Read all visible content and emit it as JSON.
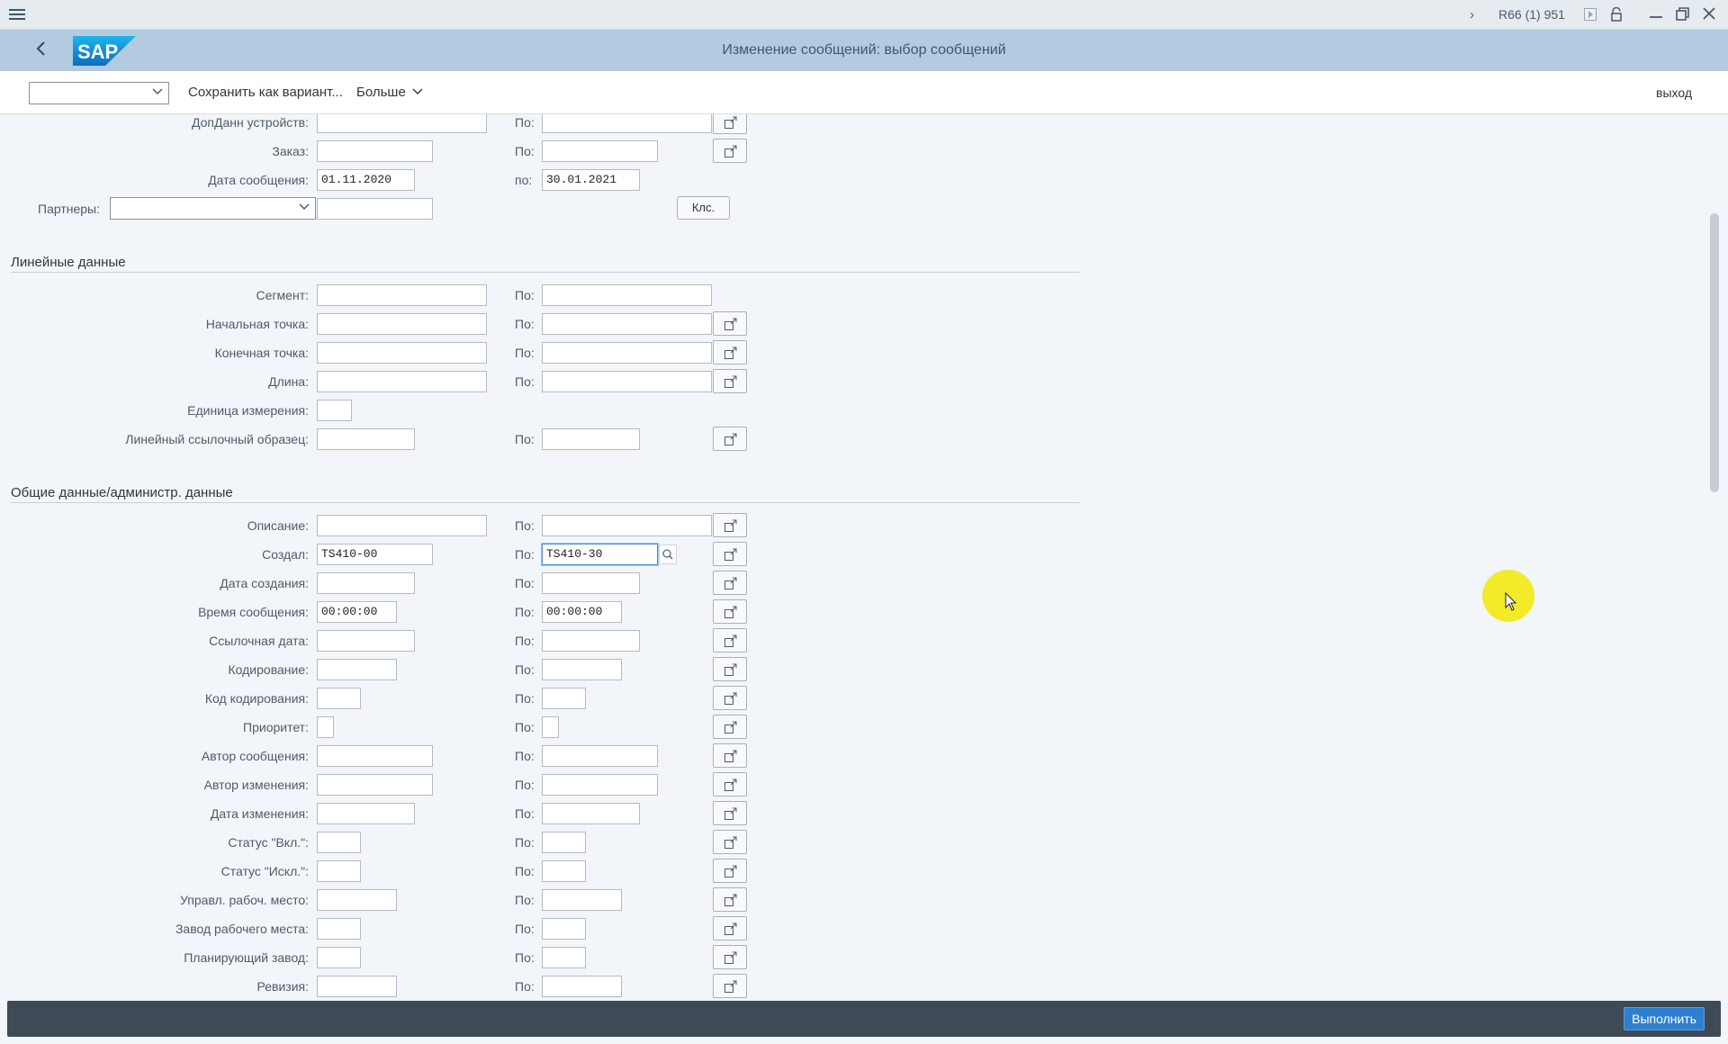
{
  "titlebar": {
    "system": "R66 (1) 951"
  },
  "header": {
    "logo": "SAP",
    "title": "Изменение сообщений: выбор сообщений"
  },
  "toolbar": {
    "variant_value": "",
    "save_variant": "Сохранить как вариант...",
    "more": "Больше",
    "exit": "выход"
  },
  "top_rows": {
    "device_data": {
      "label": "ДопДанн устройств:",
      "from": "",
      "to": ""
    },
    "order": {
      "label": "Заказ:",
      "from": "",
      "to": ""
    },
    "message_date": {
      "label": "Дата сообщения:",
      "from": "01.11.2020",
      "to_label": "по:",
      "to": "30.01.2021"
    },
    "partners": {
      "label": "Партнеры:",
      "select": "",
      "value": "",
      "button": "Клс."
    }
  },
  "po_label": "По:",
  "linear": {
    "title": "Линейные данные",
    "rows": [
      {
        "label": "Сегмент:",
        "from": "",
        "to": ""
      },
      {
        "label": "Начальная точка:",
        "from": "",
        "to": ""
      },
      {
        "label": "Конечная точка:",
        "from": "",
        "to": ""
      },
      {
        "label": "Длина:",
        "from": "",
        "to": ""
      },
      {
        "label": "Единица измерения:",
        "from": ""
      },
      {
        "label": "Линейный ссылочный образец:",
        "from": "",
        "to": ""
      }
    ]
  },
  "general": {
    "title": "Общие данные/администр. данные",
    "rows": [
      {
        "label": "Описание:",
        "from": "",
        "to": ""
      },
      {
        "label": "Создал:",
        "from": "TS410-00",
        "to": "TS410-30"
      },
      {
        "label": "Дата создания:",
        "from": "",
        "to": ""
      },
      {
        "label": "Время сообщения:",
        "from": "00:00:00",
        "to": "00:00:00"
      },
      {
        "label": "Ссылочная дата:",
        "from": "",
        "to": ""
      },
      {
        "label": "Кодирование:",
        "from": "",
        "to": ""
      },
      {
        "label": "Код кодирования:",
        "from": "",
        "to": ""
      },
      {
        "label": "Приоритет:",
        "from": "",
        "to": ""
      },
      {
        "label": "Автор сообщения:",
        "from": "",
        "to": ""
      },
      {
        "label": "Автор изменения:",
        "from": "",
        "to": ""
      },
      {
        "label": "Дата изменения:",
        "from": "",
        "to": ""
      },
      {
        "label": "Статус \"Вкл.\":",
        "from": "",
        "to": ""
      },
      {
        "label": "Статус \"Искл.\":",
        "from": "",
        "to": ""
      },
      {
        "label": "Управл. рабоч. место:",
        "from": "",
        "to": ""
      },
      {
        "label": "Завод рабочего места:",
        "from": "",
        "to": ""
      },
      {
        "label": "Планирующий завод:",
        "from": "",
        "to": ""
      },
      {
        "label": "Ревизия:",
        "from": "",
        "to": ""
      }
    ]
  },
  "footer": {
    "execute": "Выполнить"
  }
}
